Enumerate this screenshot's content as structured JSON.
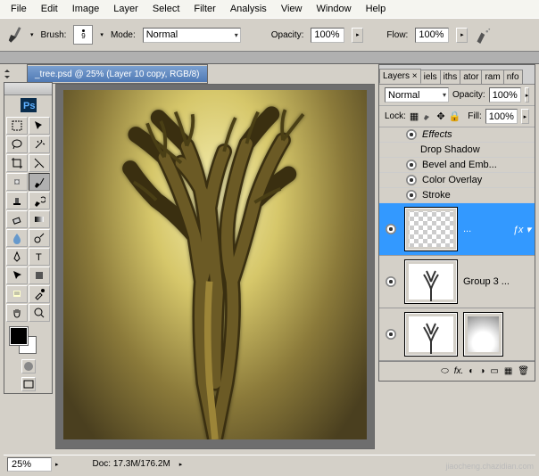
{
  "menu": {
    "file": "File",
    "edit": "Edit",
    "image": "Image",
    "layer": "Layer",
    "select": "Select",
    "filter": "Filter",
    "analysis": "Analysis",
    "view": "View",
    "window": "Window",
    "help": "Help"
  },
  "optbar": {
    "brush_label": "Brush:",
    "brush_size": "9",
    "mode_label": "Mode:",
    "mode_value": "Normal",
    "opacity_label": "Opacity:",
    "opacity_value": "100%",
    "flow_label": "Flow:",
    "flow_value": "100%"
  },
  "doc": {
    "title": "_tree.psd @ 25% (Layer 10 copy, RGB/8)"
  },
  "status": {
    "zoom": "25%",
    "doc": "Doc: 17.3M/176.2M"
  },
  "layers": {
    "tabs": [
      "Layers ×",
      "iels",
      "iths",
      "ator",
      "ram",
      "nfo"
    ],
    "blend": "Normal",
    "opacity_label": "Opacity:",
    "opacity": "100%",
    "lock_label": "Lock:",
    "fill_label": "Fill:",
    "fill": "100%",
    "effects_header": "Effects",
    "fx": [
      "Drop Shadow",
      "Bevel and Emb...",
      "Color Overlay",
      "Stroke"
    ],
    "selected_label": "...",
    "group_label": "Group 3 ...",
    "foot_fx": "fx."
  },
  "footer": {
    "credit": "jiaocheng.chazidian.com"
  }
}
